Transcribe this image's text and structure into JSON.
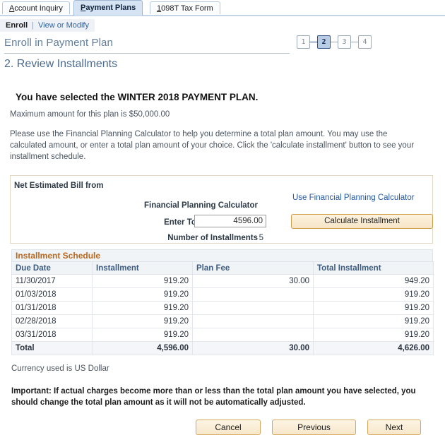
{
  "tabs": [
    {
      "label": "Account Inquiry",
      "accesskey": "A",
      "active": false
    },
    {
      "label": "Payment Plans",
      "accesskey": "P",
      "active": true
    },
    {
      "label": "1098T Tax Form",
      "accesskey": "1",
      "active": false
    }
  ],
  "subnav": {
    "current": "Enroll",
    "separator": "|",
    "link": "View or Modify"
  },
  "header": {
    "title": "Enroll in Payment Plan",
    "subtitle": "2. Review Installments"
  },
  "steps": {
    "items": [
      "1",
      "2",
      "3",
      "4"
    ],
    "current": 2
  },
  "content": {
    "lead": "You have selected the WINTER 2018 PAYMENT PLAN.",
    "maximum": "Maximum amount for this plan is $50,000.00",
    "instructions": "Please use the Financial Planning Calculator to help you determine a total plan amount. You may use the calculated amount, or enter a total plan amount of your choice. Click the 'calculate installment' button to see your installment schedule.",
    "currency_note": "Currency used is US Dollar",
    "important": "Important: If actual charges become more than or less than the total plan amount you have selected, you should change the total plan amount as it will not be automatically adjusted."
  },
  "calculator": {
    "net_estimated_bill_label": "Net Estimated Bill from",
    "financial_planning_calculator_label": "Financial Planning Calculator",
    "total_plan_amount_label": "Enter Total Plan Amount",
    "total_plan_amount_value": "4596.00",
    "number_of_installments_label": "Number of Installments",
    "number_of_installments_value": "5",
    "use_calculator_link": "Use Financial Planning Calculator",
    "calculate_button": "Calculate Installment"
  },
  "schedule": {
    "caption": "Installment Schedule",
    "columns": [
      "Due Date",
      "Installment",
      "Plan Fee",
      "Total Installment"
    ],
    "rows": [
      {
        "due_date": "11/30/2017",
        "installment": "919.20",
        "plan_fee": "30.00",
        "total": "949.20"
      },
      {
        "due_date": "01/03/2018",
        "installment": "919.20",
        "plan_fee": "",
        "total": "919.20"
      },
      {
        "due_date": "01/31/2018",
        "installment": "919.20",
        "plan_fee": "",
        "total": "919.20"
      },
      {
        "due_date": "02/28/2018",
        "installment": "919.20",
        "plan_fee": "",
        "total": "919.20"
      },
      {
        "due_date": "03/31/2018",
        "installment": "919.20",
        "plan_fee": "",
        "total": "919.20"
      }
    ],
    "total_row": {
      "due_date": "Total",
      "installment": "4,596.00",
      "plan_fee": "30.00",
      "total": "4,626.00"
    }
  },
  "buttons": {
    "cancel": "Cancel",
    "previous": "Previous",
    "next": "Next"
  },
  "colors": {
    "accent_blue": "#31629c",
    "title_blue": "#5f7e9e",
    "grid_caption_orange": "#b8671e",
    "button_border": "#d6a75c",
    "active_step": "#b9cce5"
  }
}
